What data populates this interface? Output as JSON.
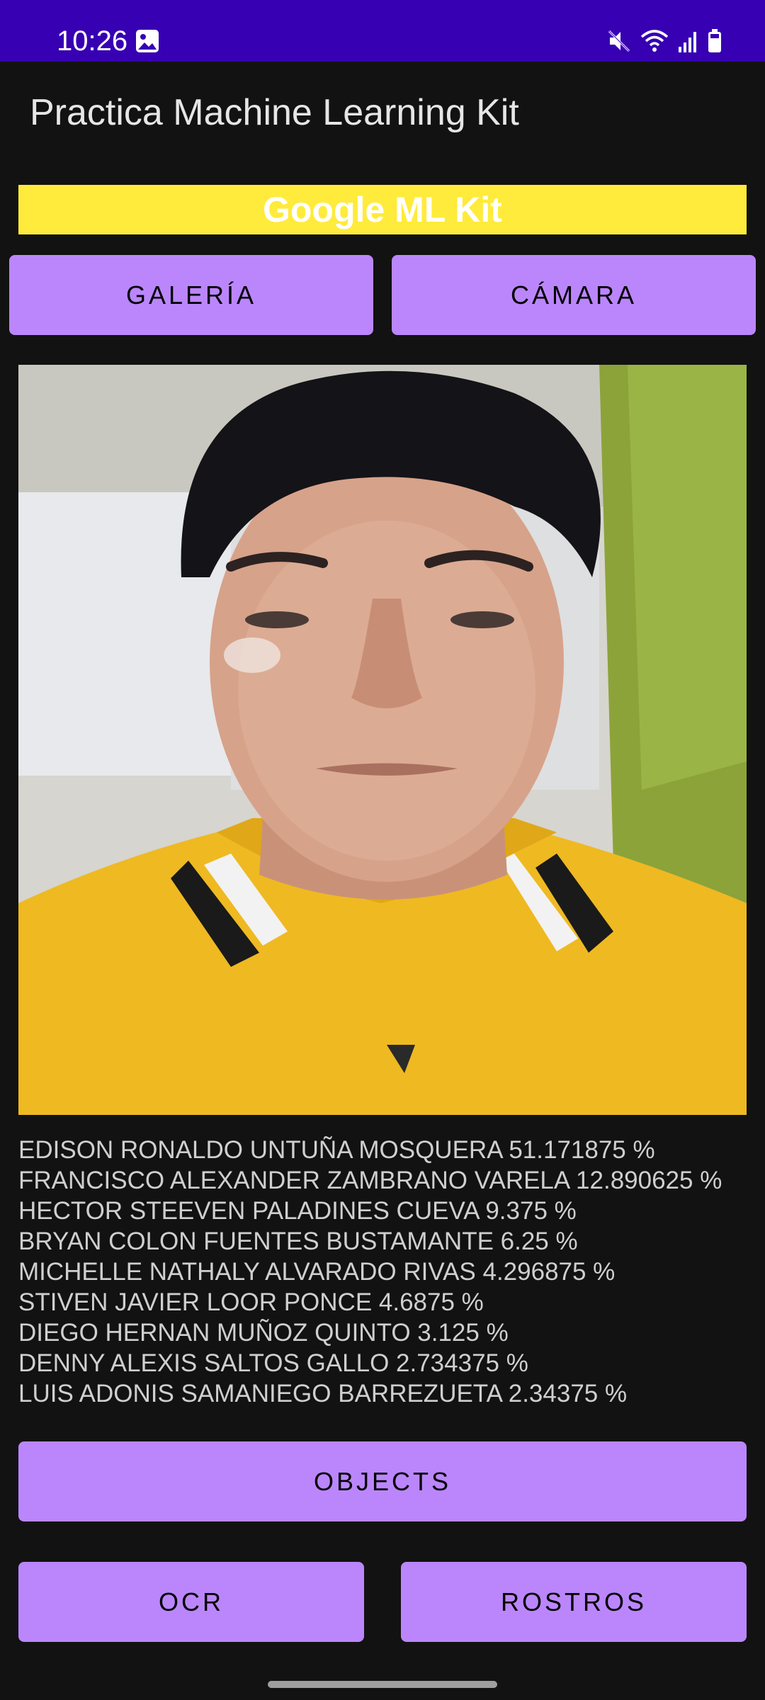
{
  "status_bar": {
    "time": "10:26",
    "icons": [
      "gallery-icon",
      "mute-icon",
      "wifi-icon",
      "signal-icon",
      "battery-icon"
    ],
    "background": "#3700b3"
  },
  "app_bar": {
    "title": "Practica Machine Learning Kit"
  },
  "banner": {
    "text": "Google ML Kit",
    "background": "#ffeb3b"
  },
  "buttons": {
    "gallery": "GALERÍA",
    "camera": "CÁMARA",
    "objects": "OBJECTS",
    "ocr": "OCR",
    "faces": "ROSTROS",
    "color": "#bb86fc"
  },
  "results": [
    "EDISON RONALDO UNTUÑA MOSQUERA 51.171875 %",
    "FRANCISCO ALEXANDER ZAMBRANO VARELA 12.890625 %",
    "HECTOR STEEVEN PALADINES CUEVA 9.375 %",
    "BRYAN COLON FUENTES BUSTAMANTE 6.25 %",
    "MICHELLE NATHALY ALVARADO RIVAS 4.296875 %",
    "STIVEN JAVIER LOOR PONCE 4.6875 %",
    "DIEGO HERNAN MUÑOZ QUINTO 3.125 %",
    "DENNY ALEXIS SALTOS GALLO 2.734375 %",
    "LUIS ADONIS SAMANIEGO BARREZUETA 2.34375 %"
  ]
}
